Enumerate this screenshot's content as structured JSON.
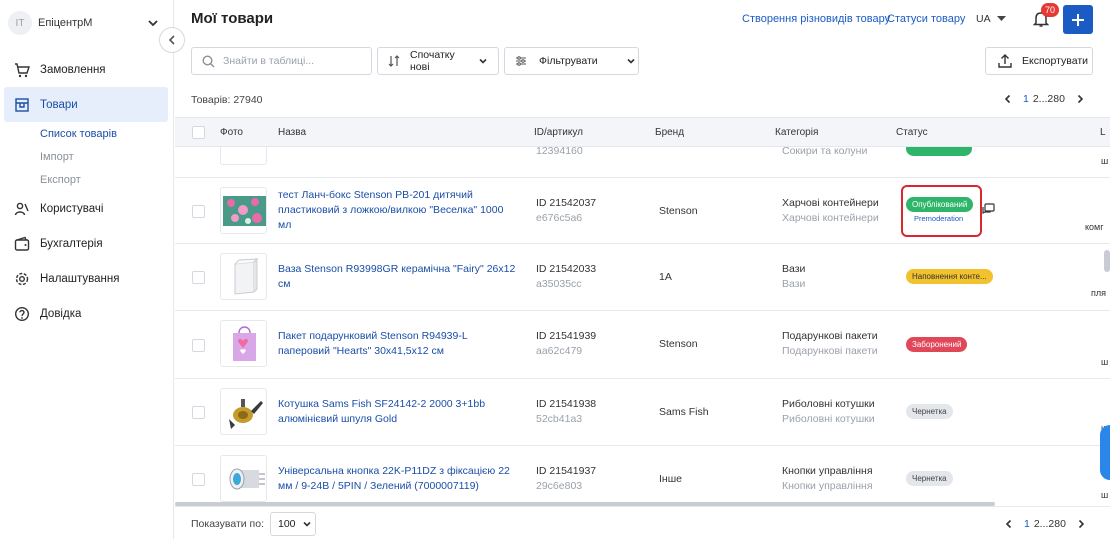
{
  "sidebar": {
    "org": {
      "avatar": "IT",
      "name": "ЕпіцентрМ"
    },
    "items": [
      {
        "label": "Замовлення",
        "icon": "cart-icon"
      },
      {
        "label": "Товари",
        "icon": "products-icon"
      },
      {
        "label": "Користувачі",
        "icon": "users-icon"
      },
      {
        "label": "Бухгалтерія",
        "icon": "wallet-icon"
      },
      {
        "label": "Налаштування",
        "icon": "gear-icon"
      },
      {
        "label": "Довідка",
        "icon": "help-icon"
      }
    ],
    "sub_items": [
      "Список товарів",
      "Імпорт",
      "Експорт"
    ]
  },
  "header": {
    "title": "Мої товари",
    "link_variants": "Створення різновидів товару",
    "link_statuses": "Статуси товару",
    "lang": "UA",
    "notifications": "70"
  },
  "toolbar": {
    "search_placeholder": "Знайти в таблиці...",
    "sort_label": "Спочатку нові",
    "filter_label": "Фільтрувати",
    "export_label": "Експортувати"
  },
  "summary": {
    "count": "Товарів: 27940"
  },
  "pagination": {
    "current": "1",
    "rest": "2...280"
  },
  "table": {
    "headers": {
      "photo": "Фото",
      "name": "Назва",
      "id": "ID/артикул",
      "brand": "Бренд",
      "category": "Категорія",
      "status": "Статус",
      "extra": "L"
    },
    "partial_row": {
      "sku": "12394160",
      "category_sub": "Сокири та колуни"
    },
    "rows": [
      {
        "name": "тест Ланч-бокс Stenson PB-201 дитячий пластиковий з ложкою/вилкою \"Веселка\" 1000 мл",
        "id": "ID 21542037",
        "sku": "e676c5a6",
        "brand": "Stenson",
        "category": "Харчові контейнери",
        "category_sub": "Харчові контейнери",
        "status": "Опублікований",
        "moderation": "Premoderation",
        "right": "комг"
      },
      {
        "name": "Ваза Stenson R93998GR керамічна \"Fairy\" 26х12 см",
        "id": "ID 21542033",
        "sku": "a35035cc",
        "brand": "1A",
        "category": "Вази",
        "category_sub": "Вази",
        "status": "Наповнення конте...",
        "right": "пля"
      },
      {
        "name": "Пакет подарунковий Stenson R94939-L паперовий \"Hearts\" 30х41,5х12 см",
        "id": "ID 21541939",
        "sku": "aa62c479",
        "brand": "Stenson",
        "category": "Подарункові пакети",
        "category_sub": "Подарункові пакети",
        "status": "Заборонений",
        "right": "ш"
      },
      {
        "name": "Котушка Sams Fish SF24142-2 2000 3+1bb алюмінієвий шпуля Gold",
        "id": "ID 21541938",
        "sku": "52cb41a3",
        "brand": "Sams Fish",
        "category": "Риболовні котушки",
        "category_sub": "Риболовні котушки",
        "status": "Чернетка",
        "right": "ш"
      },
      {
        "name": "Універсальна кнопка 22K-P11DZ з фіксацією 22 мм / 9-24В / 5PIN / Зелений (7000007119)",
        "id": "ID 21541937",
        "sku": "29c6e803",
        "brand": "Інше",
        "category": "Кнопки управління",
        "category_sub": "Кнопки управління",
        "status": "Чернетка",
        "right": "ш"
      }
    ]
  },
  "footer": {
    "show_label": "Показувати по:",
    "per_page": "100"
  },
  "colors": {
    "accent": "#1a5bc4",
    "published": "#2fb56a",
    "filling": "#f2c12e",
    "banned": "#e0485a",
    "draft": "#e3e6ea",
    "highlight": "#d9262f"
  }
}
